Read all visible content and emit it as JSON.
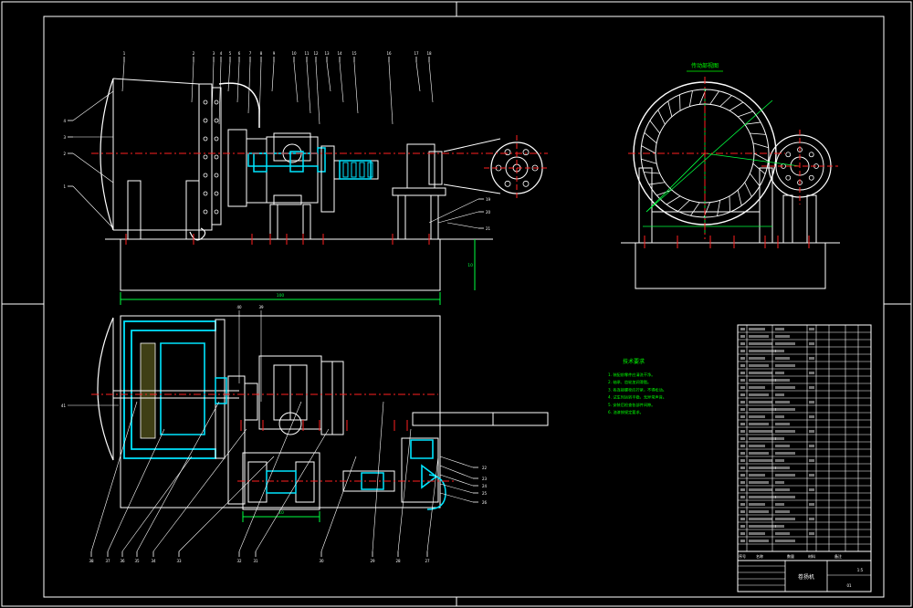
{
  "colors": {
    "background": "#000000",
    "line": "#ffffff",
    "center_line": "#ff2020",
    "hatch": "#00e5ff",
    "dimension": "#00ff40",
    "note_text": "#00ff00"
  },
  "views": {
    "front": "front-elevation-view",
    "side": "side-elevation-view",
    "plan": "plan-section-view"
  },
  "leader_labels": {
    "front_top": [
      "1",
      "2",
      "3",
      "4",
      "5",
      "6",
      "7",
      "8",
      "9",
      "10",
      "11",
      "12",
      "13",
      "14",
      "15",
      "16",
      "17",
      "18"
    ],
    "front_left": [
      "4",
      "3",
      "2",
      "1"
    ],
    "front_right": [
      "19",
      "20",
      "21"
    ],
    "plan_bottom": [
      "38",
      "37",
      "36",
      "35",
      "34",
      "33",
      "32",
      "31",
      "30",
      "29",
      "28",
      "27"
    ],
    "plan_right": [
      "22",
      "23",
      "24",
      "25",
      "26"
    ],
    "plan_top": [
      "40",
      "39"
    ],
    "plan_left": "41"
  },
  "dimensions": {
    "front_overall": "100",
    "front_height": "10",
    "plan_span": "10"
  },
  "side_view_title": "传动部视图",
  "notes": {
    "title": "技术要求",
    "items": [
      "1. 装配前零件应清洗干净。",
      "2. 轴承、齿轮加润滑脂。",
      "3. 各连接螺栓应拧紧，不得松动。",
      "4. 试车时运转平稳，无异常声音。",
      "5. 安装后检查各部件间隙。",
      "6. 油漆按规定要求。"
    ]
  },
  "title_block": {
    "drawing_name": "卷扬机",
    "header_labels": [
      "序号",
      "名称",
      "数量",
      "材料",
      "备注"
    ],
    "scale": "1:5",
    "sheet": "01"
  }
}
